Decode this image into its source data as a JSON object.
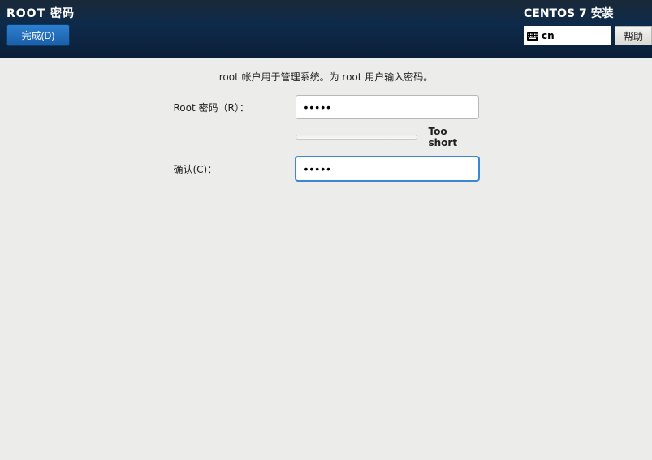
{
  "header": {
    "page_title": "ROOT 密码",
    "done_label": "完成(D)",
    "installer_title": "CENTOS 7 安装",
    "keyboard_layout": "cn",
    "help_label": "帮助"
  },
  "form": {
    "description": "root 帐户用于管理系统。为 root 用户输入密码。",
    "password_label": "Root 密码（R）：",
    "password_value": "•••••",
    "confirm_label": "确认(C)：",
    "confirm_value": "•••••",
    "strength_text": "Too short"
  }
}
